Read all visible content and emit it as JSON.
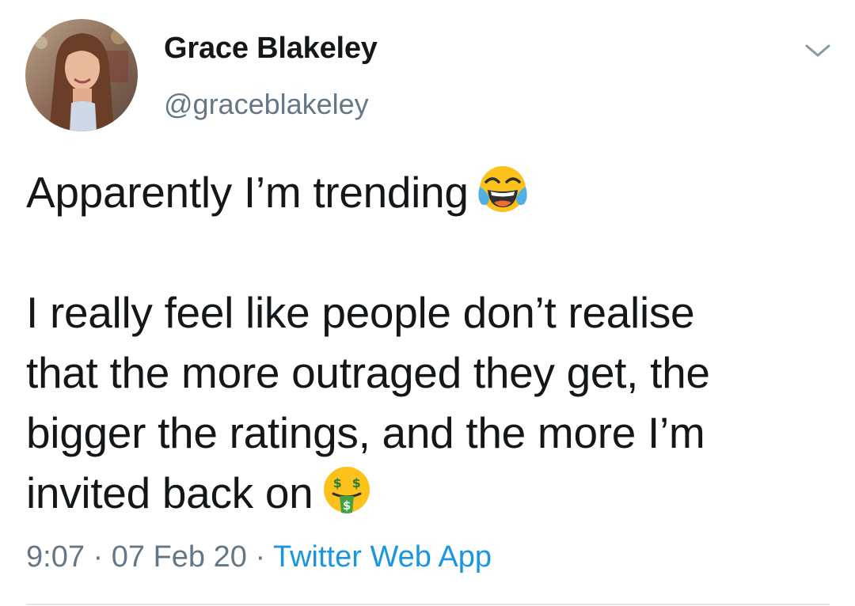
{
  "author": {
    "display_name": "Grace Blakeley",
    "handle": "@graceblakeley"
  },
  "tweet": {
    "lines": [
      "Apparently I’m trending",
      "",
      "I really feel like people don’t realise",
      "that the more outraged they get, the",
      "bigger the ratings, and the more I’m",
      "invited back on"
    ],
    "emojis": {
      "line_0": "face-with-tears-of-joy-icon",
      "line_5": "money-mouth-face-icon"
    }
  },
  "meta": {
    "time": "9:07",
    "separator": "·",
    "date": "07 Feb 20",
    "source": "Twitter Web App"
  },
  "colors": {
    "text": "#14171a",
    "secondary": "#657786",
    "link": "#1b95e0",
    "divider": "#e1e8ed"
  }
}
